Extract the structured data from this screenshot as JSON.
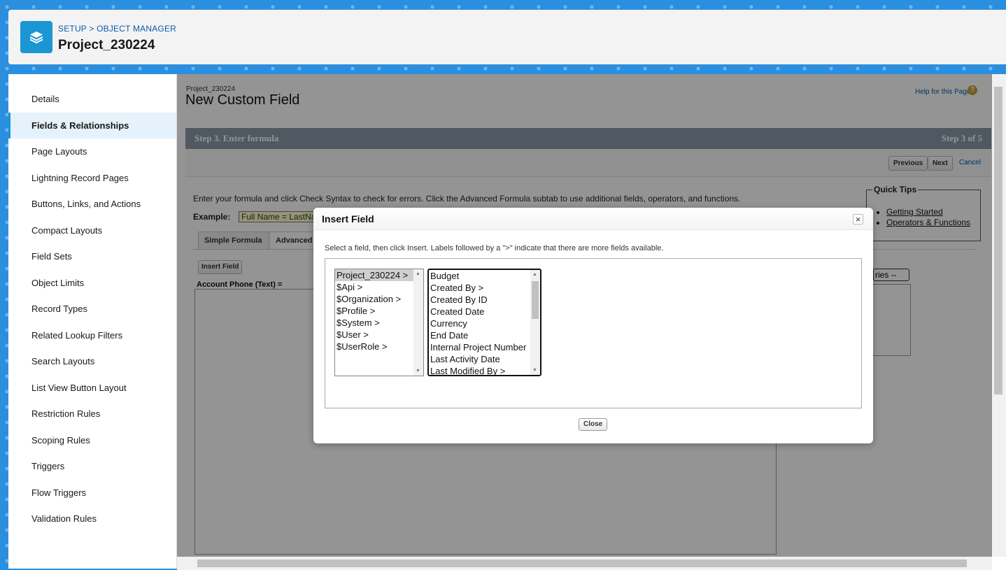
{
  "header": {
    "breadcrumb_setup": "SETUP",
    "breadcrumb_sep": ">",
    "breadcrumb_object_manager": "OBJECT MANAGER",
    "title": "Project_230224"
  },
  "sidebar": {
    "items": [
      {
        "label": "Details",
        "active": false
      },
      {
        "label": "Fields & Relationships",
        "active": true
      },
      {
        "label": "Page Layouts",
        "active": false
      },
      {
        "label": "Lightning Record Pages",
        "active": false
      },
      {
        "label": "Buttons, Links, and Actions",
        "active": false
      },
      {
        "label": "Compact Layouts",
        "active": false
      },
      {
        "label": "Field Sets",
        "active": false
      },
      {
        "label": "Object Limits",
        "active": false
      },
      {
        "label": "Record Types",
        "active": false
      },
      {
        "label": "Related Lookup Filters",
        "active": false
      },
      {
        "label": "Search Layouts",
        "active": false
      },
      {
        "label": "List View Button Layout",
        "active": false
      },
      {
        "label": "Restriction Rules",
        "active": false
      },
      {
        "label": "Scoping Rules",
        "active": false
      },
      {
        "label": "Triggers",
        "active": false
      },
      {
        "label": "Flow Triggers",
        "active": false
      },
      {
        "label": "Validation Rules",
        "active": false
      }
    ]
  },
  "page": {
    "object_name": "Project_230224",
    "title": "New Custom Field",
    "help_link": "Help for this Page",
    "help_icon": "?",
    "step_title": "Step 3. Enter formula",
    "step_count": "Step 3 of 5",
    "previous_label": "Previous",
    "next_label": "Next",
    "cancel_label": "Cancel",
    "instructions": "Enter your formula and click Check Syntax to check for errors. Click the Advanced Formula subtab to use additional fields, operators, and functions.",
    "example_label": "Example:",
    "example_value": "Full Name = LastName",
    "tab_simple": "Simple Formula",
    "tab_advanced": "Advanced",
    "insert_field_label": "Insert Field",
    "formula_label": "Account Phone (Text) =",
    "quick_tips_title": "Quick Tips",
    "quick_tips_links": [
      "Getting Started",
      "Operators & Functions"
    ],
    "functions_select": "ries --"
  },
  "modal": {
    "title": "Insert Field",
    "close_x": "×",
    "instructions": "Select a field, then click Insert. Labels followed by a \">\" indicate that there are more fields available.",
    "left_list": [
      "Project_230224 >",
      "$Api >",
      "$Organization >",
      "$Profile >",
      "$System >",
      "$User >",
      "$UserRole >"
    ],
    "left_selected": "Project_230224 >",
    "right_list": [
      "Budget",
      "Created By >",
      "Created By ID",
      "Created Date",
      "Currency",
      "End Date",
      "Internal Project Number",
      "Last Activity Date",
      "Last Modified By >"
    ],
    "close_label": "Close"
  }
}
